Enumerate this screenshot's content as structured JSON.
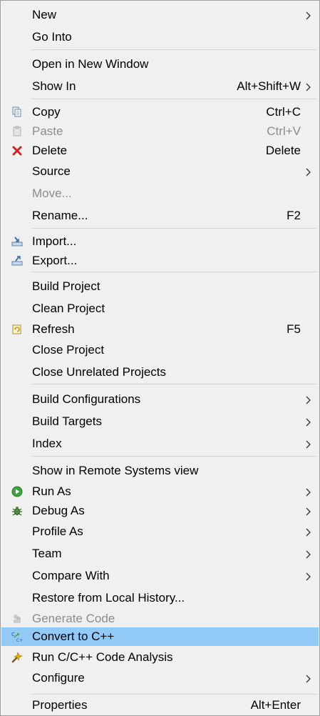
{
  "menu": {
    "items": [
      {
        "label": "New",
        "shortcut": "",
        "submenu": true
      },
      {
        "label": "Go Into",
        "shortcut": ""
      },
      {
        "label": "Open in New Window",
        "shortcut": ""
      },
      {
        "label": "Show In",
        "shortcut": "Alt+Shift+W",
        "submenu": true
      },
      {
        "label": "Copy",
        "shortcut": "Ctrl+C",
        "icon": "copy-icon"
      },
      {
        "label": "Paste",
        "shortcut": "Ctrl+V",
        "icon": "paste-icon",
        "disabled": true
      },
      {
        "label": "Delete",
        "shortcut": "Delete",
        "icon": "delete-icon"
      },
      {
        "label": "Source",
        "shortcut": "",
        "submenu": true
      },
      {
        "label": "Move...",
        "shortcut": "",
        "disabled": true
      },
      {
        "label": "Rename...",
        "shortcut": "F2"
      },
      {
        "label": "Import...",
        "shortcut": "",
        "icon": "import-icon"
      },
      {
        "label": "Export...",
        "shortcut": "",
        "icon": "export-icon"
      },
      {
        "label": "Build Project",
        "shortcut": ""
      },
      {
        "label": "Clean Project",
        "shortcut": ""
      },
      {
        "label": "Refresh",
        "shortcut": "F5",
        "icon": "refresh-icon"
      },
      {
        "label": "Close Project",
        "shortcut": ""
      },
      {
        "label": "Close Unrelated Projects",
        "shortcut": ""
      },
      {
        "label": "Build Configurations",
        "shortcut": "",
        "submenu": true
      },
      {
        "label": "Build Targets",
        "shortcut": "",
        "submenu": true
      },
      {
        "label": "Index",
        "shortcut": "",
        "submenu": true
      },
      {
        "label": "Show in Remote Systems view",
        "shortcut": ""
      },
      {
        "label": "Run As",
        "shortcut": "",
        "icon": "run-icon",
        "submenu": true
      },
      {
        "label": "Debug As",
        "shortcut": "",
        "icon": "debug-icon",
        "submenu": true
      },
      {
        "label": "Profile As",
        "shortcut": "",
        "submenu": true
      },
      {
        "label": "Team",
        "shortcut": "",
        "submenu": true
      },
      {
        "label": "Compare With",
        "shortcut": "",
        "submenu": true
      },
      {
        "label": "Restore from Local History...",
        "shortcut": ""
      },
      {
        "label": "Generate Code",
        "shortcut": "",
        "icon": "generate-code-icon",
        "disabled": true
      },
      {
        "label": "Convert to C++",
        "shortcut": "",
        "icon": "convert-cpp-icon",
        "highlighted": true
      },
      {
        "label": "Run C/C++ Code Analysis",
        "shortcut": "",
        "icon": "code-analysis-icon"
      },
      {
        "label": "Configure",
        "shortcut": "",
        "submenu": true
      },
      {
        "label": "Properties",
        "shortcut": "Alt+Enter"
      }
    ],
    "colors": {
      "background": "#f0f0f0",
      "highlight": "#91c9f7",
      "disabled_text": "#8c8c8c",
      "separator": "#d4d4d4"
    }
  }
}
